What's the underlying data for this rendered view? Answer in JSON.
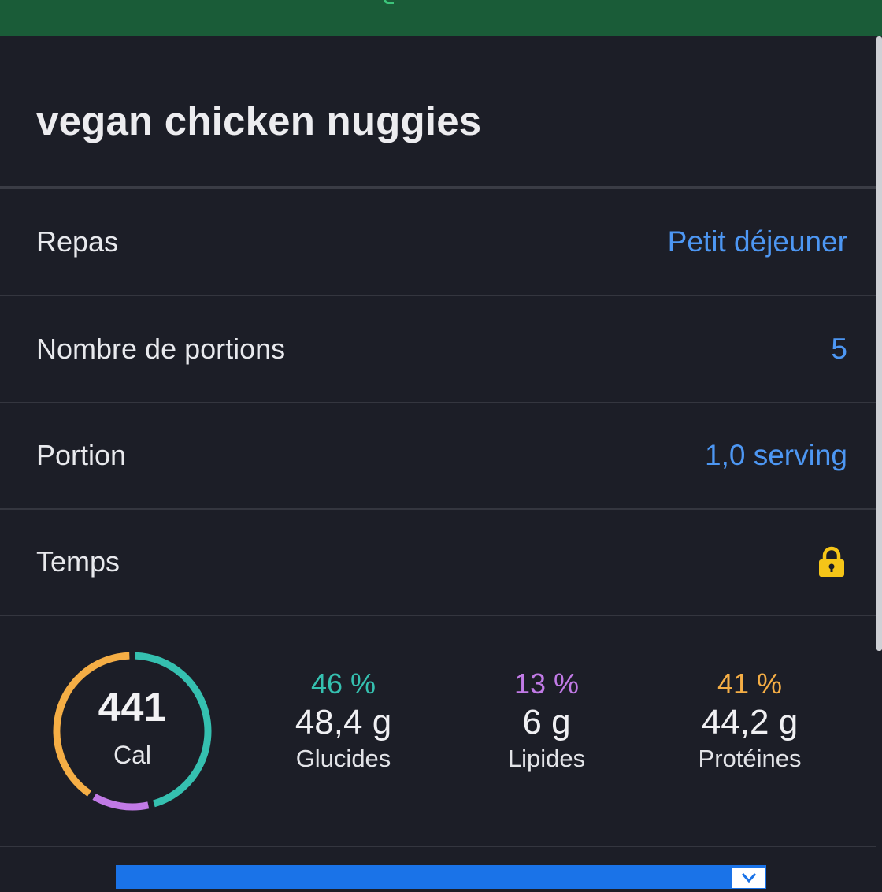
{
  "topbar": {
    "color": "#1a5c38"
  },
  "title": "vegan chicken nuggies",
  "rows": [
    {
      "label": "Repas",
      "value": "Petit déjeuner"
    },
    {
      "label": "Nombre de portions",
      "value": "5"
    },
    {
      "label": "Portion",
      "value": "1,0 serving"
    },
    {
      "label": "Temps",
      "icon": "lock-icon"
    }
  ],
  "summary": {
    "calories": "441",
    "calories_unit": "Cal",
    "macros": [
      {
        "percent": "46 %",
        "grams": "48,4 g",
        "label": "Glucides",
        "color": "#35c0b0",
        "fraction": 0.46
      },
      {
        "percent": "13 %",
        "grams": "6 g",
        "label": "Lipides",
        "color": "#c17ae6",
        "fraction": 0.13
      },
      {
        "percent": "41 %",
        "grams": "44,2 g",
        "label": "Protéines",
        "color": "#f5ae45",
        "fraction": 0.41
      }
    ]
  },
  "colors": {
    "accent": "#4d97f3",
    "lock": "#f5c518",
    "background": "#1c1e27"
  }
}
